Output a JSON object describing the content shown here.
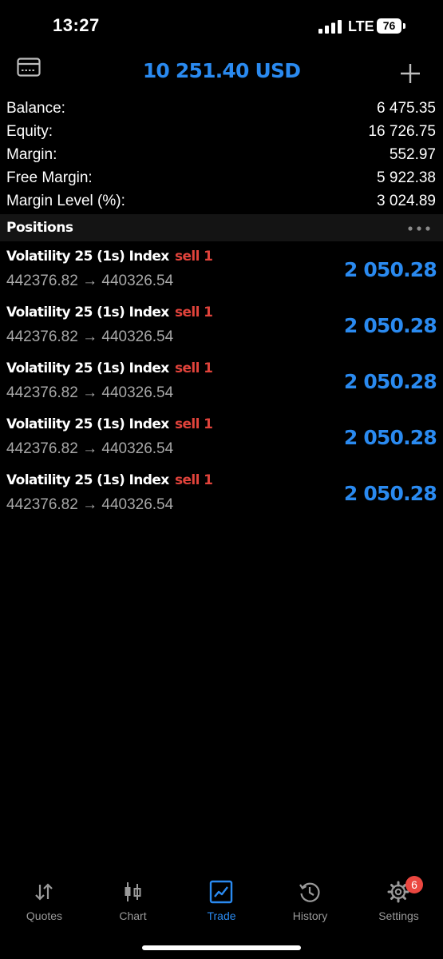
{
  "status_bar": {
    "time": "13:27",
    "network": "LTE",
    "battery": "76"
  },
  "header": {
    "title": "10 251.40 USD",
    "left_icon": "account-card-icon",
    "right_icon": "plus-icon"
  },
  "summary": [
    {
      "label": "Balance:",
      "value": "6 475.35"
    },
    {
      "label": "Equity:",
      "value": "16 726.75"
    },
    {
      "label": "Margin:",
      "value": "552.97"
    },
    {
      "label": "Free Margin:",
      "value": "5 922.38"
    },
    {
      "label": "Margin Level (%):",
      "value": "3 024.89"
    }
  ],
  "positions": {
    "title": "Positions",
    "items": [
      {
        "symbol": "Volatility 25 (1s) Index",
        "side": "sell 1",
        "prices": "442376.82 → 440326.54",
        "profit": "2 050.28"
      },
      {
        "symbol": "Volatility 25 (1s) Index",
        "side": "sell 1",
        "prices": "442376.82 → 440326.54",
        "profit": "2 050.28"
      },
      {
        "symbol": "Volatility 25 (1s) Index",
        "side": "sell 1",
        "prices": "442376.82 → 440326.54",
        "profit": "2 050.28"
      },
      {
        "symbol": "Volatility 25 (1s) Index",
        "side": "sell 1",
        "prices": "442376.82 → 440326.54",
        "profit": "2 050.28"
      },
      {
        "symbol": "Volatility 25 (1s) Index",
        "side": "sell 1",
        "prices": "442376.82 → 440326.54",
        "profit": "2 050.28"
      }
    ]
  },
  "tabs": [
    {
      "label": "Quotes",
      "icon": "quotes-arrows-icon",
      "active": false
    },
    {
      "label": "Chart",
      "icon": "candlestick-icon",
      "active": false
    },
    {
      "label": "Trade",
      "icon": "trade-chart-icon",
      "active": true
    },
    {
      "label": "History",
      "icon": "history-clock-icon",
      "active": false
    },
    {
      "label": "Settings",
      "icon": "gear-icon",
      "active": false,
      "badge": "6"
    }
  ],
  "colors": {
    "accent_blue": "#2a8af0",
    "sell_red": "#e0433b",
    "badge_red": "#eb4740",
    "background": "#000000",
    "section_header_bg": "#141414",
    "muted_text": "#a8a8a8"
  }
}
